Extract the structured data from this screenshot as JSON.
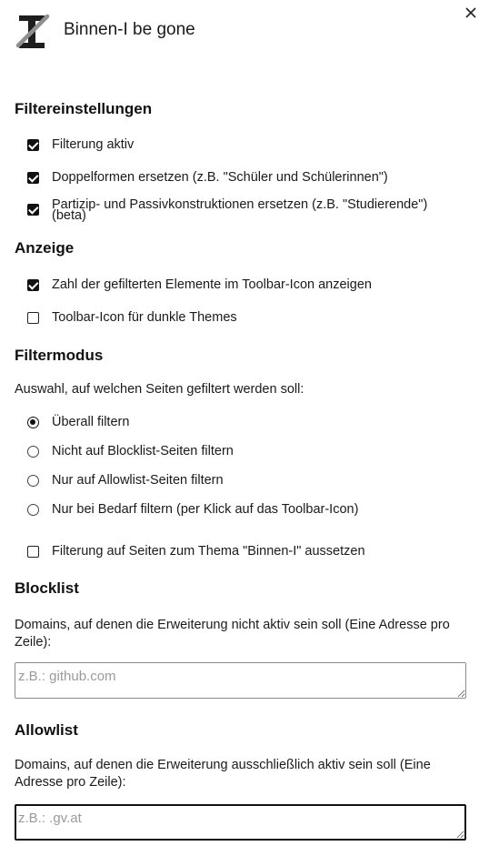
{
  "header": {
    "title": "Binnen-I be gone",
    "close_icon": "close-icon",
    "logo_icon": "crossed-letter-i-logo"
  },
  "filter_settings": {
    "heading": "Filtereinstellungen",
    "options": [
      {
        "label": "Filterung aktiv",
        "checked": true
      },
      {
        "label": "Doppelformen ersetzen (z.B. \"Schüler und Schülerinnen\")",
        "checked": true
      },
      {
        "label_line1": "Partizip- und Passivkonstruktionen ersetzen (z.B. \"Studierende\")",
        "label_line2": "(beta)",
        "checked": true
      }
    ]
  },
  "display": {
    "heading": "Anzeige",
    "options": [
      {
        "label": "Zahl der gefilterten Elemente im Toolbar-Icon anzeigen",
        "checked": true
      },
      {
        "label": "Toolbar-Icon für dunkle Themes",
        "checked": false
      }
    ]
  },
  "filter_mode": {
    "heading": "Filtermodus",
    "description": "Auswahl, auf welchen Seiten gefiltert werden soll:",
    "options": [
      {
        "label": "Überall filtern",
        "selected": true
      },
      {
        "label": "Nicht auf Blocklist-Seiten filtern",
        "selected": false
      },
      {
        "label": "Nur auf Allowlist-Seiten filtern",
        "selected": false
      },
      {
        "label": "Nur bei Bedarf filtern (per Klick auf das Toolbar-Icon)",
        "selected": false
      }
    ],
    "suspend_option": {
      "label": "Filterung auf Seiten zum Thema \"Binnen-I\" aussetzen",
      "checked": false
    }
  },
  "blocklist": {
    "heading": "Blocklist",
    "description_line1": "Domains, auf denen die Erweiterung nicht aktiv sein soll (Eine Adresse pro",
    "description_line2": "Zeile):",
    "placeholder": "z.B.: github.com",
    "value": ""
  },
  "allowlist": {
    "heading": "Allowlist",
    "description_line1": "Domains, auf denen die Erweiterung ausschließlich aktiv sein soll (Eine",
    "description_line2": "Adresse pro Zeile):",
    "placeholder": "z.B.: .gv.at",
    "value": ""
  }
}
